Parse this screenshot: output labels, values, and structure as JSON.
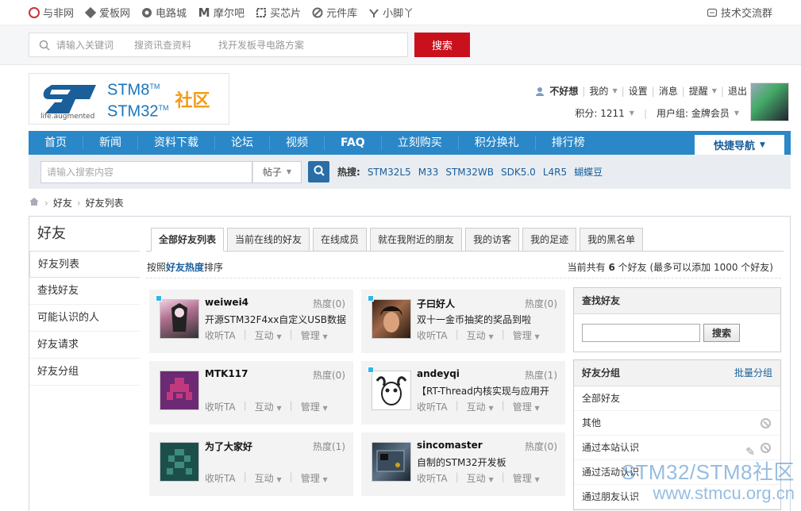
{
  "topbar": {
    "sites": [
      {
        "icon": "yufei-logo-icon",
        "label": "与非网"
      },
      {
        "icon": "aibanwang-logo-icon",
        "label": "爱板网"
      },
      {
        "icon": "dianlucheng-logo-icon",
        "label": "电路城"
      },
      {
        "icon": "moerba-logo-icon",
        "label": "摩尔吧"
      },
      {
        "icon": "maixinpian-logo-icon",
        "label": "买芯片"
      },
      {
        "icon": "yuanjianku-logo-icon",
        "label": "元件库"
      },
      {
        "icon": "xiaojiaoya-logo-icon",
        "label": "小脚丫"
      }
    ],
    "tech_group": "技术交流群"
  },
  "top_search": {
    "placeholder": "请输入关键词",
    "hint1": "搜资讯查资料",
    "hint2": "找开发板寻电路方案",
    "button": "搜索"
  },
  "logo": {
    "line1": "STM8",
    "line2": "STM32",
    "tm": "TM",
    "cn": "社区",
    "tagline": "life.augmented"
  },
  "user": {
    "name": "不好想",
    "mine": "我的",
    "settings": "设置",
    "messages": "消息",
    "reminders": "提醒",
    "logout": "退出",
    "points": "积分: 1211",
    "group": "用户组: 金牌会员"
  },
  "nav": {
    "items": [
      "首页",
      "新闻",
      "资料下载",
      "论坛",
      "视频",
      "FAQ",
      "立刻购买",
      "积分换礼",
      "排行榜"
    ],
    "quick": "快捷导航"
  },
  "forum_search": {
    "placeholder": "请输入搜索内容",
    "type": "帖子",
    "hot_label": "热搜:",
    "hot": [
      "STM32L5",
      "M33",
      "STM32WB",
      "SDK5.0",
      "L4R5",
      "蝴蝶豆"
    ]
  },
  "breadcrumb": [
    "好友",
    "好友列表"
  ],
  "sidebar": {
    "title": "好友",
    "items": [
      "好友列表",
      "查找好友",
      "可能认识的人",
      "好友请求",
      "好友分组"
    ]
  },
  "tabs": [
    "全部好友列表",
    "当前在线的好友",
    "在线成员",
    "就在我附近的朋友",
    "我的访客",
    "我的足迹",
    "我的黑名单"
  ],
  "sort": {
    "prefix": "按照",
    "link": "好友热度",
    "suffix": "排序"
  },
  "count": {
    "prefix": "当前共有 ",
    "num": "6",
    "suffix": " 个好友 (最多可以添加 1000 个好友)"
  },
  "friends": [
    {
      "name": "weiwei4",
      "heat": "热度(0)",
      "desc": "开源STM32F4xx自定义USB数据",
      "online": true
    },
    {
      "name": "子曰好人",
      "heat": "热度(0)",
      "desc": "双十一金币抽奖的奖品到啦",
      "online": true
    },
    {
      "name": "MTK117",
      "heat": "热度(0)",
      "desc": "",
      "online": false
    },
    {
      "name": "andeyqi",
      "heat": "热度(1)",
      "desc": "【RT-Thread内核实现与应用开",
      "online": true
    },
    {
      "name": "为了大家好",
      "heat": "热度(1)",
      "desc": "",
      "online": false
    },
    {
      "name": "sincomaster",
      "heat": "热度(0)",
      "desc": "自制的STM32开发板",
      "online": false
    }
  ],
  "card_actions": {
    "follow": "收听TA",
    "interact": "互动",
    "manage": "管理"
  },
  "find_friend": {
    "title": "查找好友",
    "button": "搜索"
  },
  "friend_groups": {
    "title": "好友分组",
    "batch": "批量分组",
    "items": [
      "全部好友",
      "其他",
      "通过本站认识",
      "通过活动认识",
      "通过朋友认识"
    ]
  },
  "watermark": {
    "line1": "STM32/STM8社区",
    "line2": "www.stmcu.org.cn"
  },
  "colors": {
    "nav": "#2a87c8",
    "search_button": "#c9111e",
    "link": "#1a5e9a",
    "online_dot": "#2fb7ec"
  }
}
